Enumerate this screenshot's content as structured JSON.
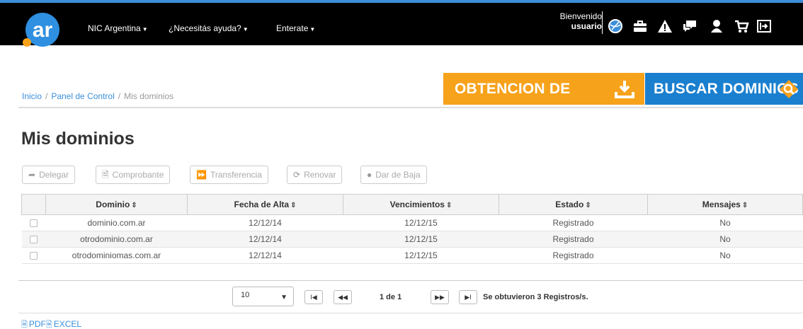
{
  "nav": {
    "menus": [
      "NIC Argentina",
      "¿Necesitás ayuda?",
      "Enterate"
    ],
    "welcome": "Bienvenido",
    "user": "usuario",
    "icons": [
      "globe-icon",
      "briefcase-icon",
      "warning-icon",
      "chat-icon",
      "user-icon",
      "cart-icon",
      "logout-icon"
    ]
  },
  "cta": {
    "obtencion": "OBTENCION DE DOMINIOS",
    "buscar": "BUSCAR DOMINIOS"
  },
  "breadcrumb": {
    "inicio": "Inicio",
    "panel": "Panel de Control",
    "current": "Mis dominios"
  },
  "page_title": "Mis dominios",
  "toolbar": {
    "delegar": "Delegar",
    "comprobante": "Comprobante",
    "transferencia": "Transferencia",
    "renovar": "Renovar",
    "baja": "Dar de Baja"
  },
  "table": {
    "headers": [
      "Dominio",
      "Fecha de Alta",
      "Vencimientos",
      "Estado",
      "Mensajes"
    ],
    "rows": [
      [
        "dominio.com.ar",
        "12/12/14",
        "12/12/15",
        "Registrado",
        "No"
      ],
      [
        "otrodominio.com.ar",
        "12/12/14",
        "12/12/15",
        "Registrado",
        "No"
      ],
      [
        "otrodominiomas.com.ar",
        "12/12/14",
        "12/12/15",
        "Registrado",
        "No"
      ]
    ]
  },
  "pager": {
    "page_size": "10",
    "page_info": "1 de 1",
    "records": "Se obtuvieron 3 Registros/s."
  },
  "export": {
    "pdf": "PDF",
    "excel": "EXCEL"
  },
  "colors": {
    "accent_blue": "#1a7fcf",
    "accent_orange": "#f7a21b",
    "navbar": "#000000"
  }
}
